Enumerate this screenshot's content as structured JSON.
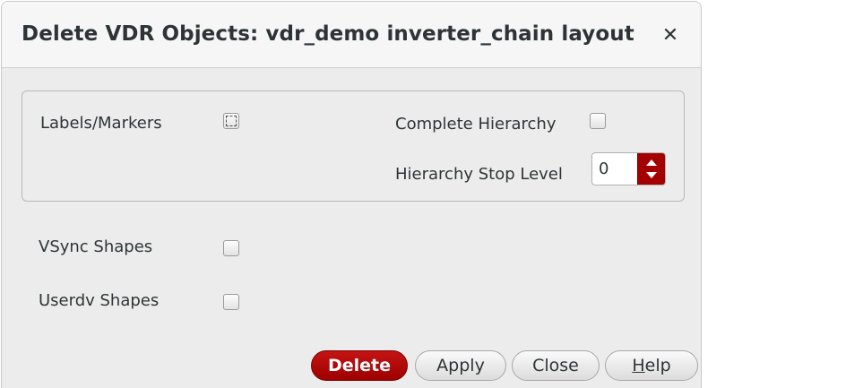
{
  "dialog": {
    "title": "Delete VDR Objects: vdr_demo inverter_chain layout",
    "close_glyph": "✕"
  },
  "options": {
    "labels_markers": {
      "label": "Labels/Markers",
      "checked": false
    },
    "complete_hierarchy": {
      "label": "Complete Hierarchy",
      "checked": false
    },
    "hierarchy_stop_level": {
      "label": "Hierarchy Stop Level",
      "value": "0"
    },
    "vsync_shapes": {
      "label": "VSync Shapes",
      "checked": false
    },
    "userdv_shapes": {
      "label": "Userdv Shapes",
      "checked": false
    }
  },
  "buttons": {
    "delete": "Delete",
    "apply": "Apply",
    "close": "Close",
    "help_mnemonic": "H",
    "help_rest": "elp"
  },
  "icons": {
    "close": "close-icon",
    "spin_up": "arrow-up-icon",
    "spin_down": "arrow-down-icon"
  },
  "colors": {
    "accent": "#a40000",
    "background": "#ececec"
  }
}
